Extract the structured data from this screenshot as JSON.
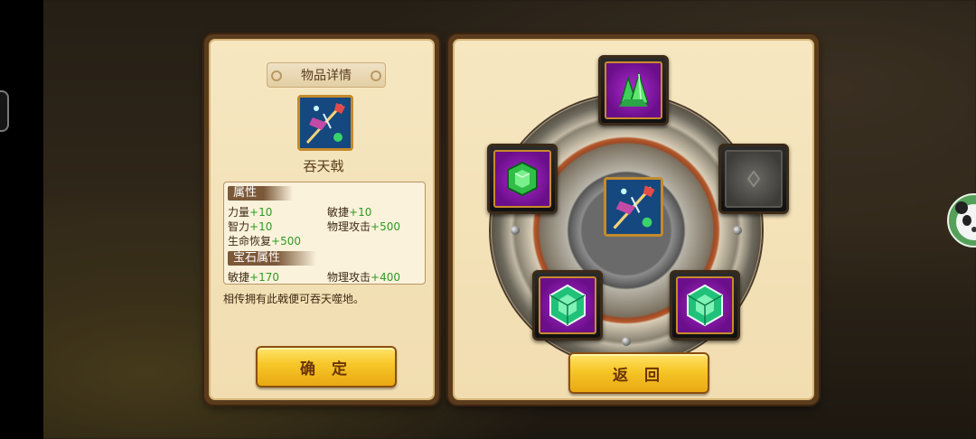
{
  "left_panel": {
    "title": "物品详情",
    "item_name": "吞天戟",
    "attributes_heading": "属性",
    "attributes": [
      {
        "label": "力量",
        "value": "+10"
      },
      {
        "label": "敏捷",
        "value": "+10"
      },
      {
        "label": "智力",
        "value": "+10"
      },
      {
        "label": "物理攻击",
        "value": "+500"
      },
      {
        "label": "生命恢复",
        "value": "+500"
      }
    ],
    "gem_heading": "宝石属性",
    "gem_attributes": [
      {
        "label": "敏捷",
        "value": "+170"
      },
      {
        "label": "物理攻击",
        "value": "+400"
      }
    ],
    "description": "相传拥有此戟便可吞天噬地。",
    "confirm_label": "确 定"
  },
  "right_panel": {
    "back_label": "返 回",
    "slots": [
      {
        "position": "top",
        "gem": "green-crystal-cluster-icon",
        "filled": true
      },
      {
        "position": "left",
        "gem": "green-square-gem-icon",
        "filled": true
      },
      {
        "position": "right",
        "gem": "empty-slot-icon",
        "filled": false
      },
      {
        "position": "bottom-left",
        "gem": "green-hexagon-gem-icon",
        "filled": true
      },
      {
        "position": "bottom-right",
        "gem": "green-hexagon-gem-icon",
        "filled": true
      }
    ],
    "center_item": "halberd-weapon-icon"
  },
  "colors": {
    "panel_bg": "#f1ddb0",
    "button_gold": "#f6c627",
    "value_green": "#2e9b22",
    "slot_purple": "#8a1cb0"
  }
}
